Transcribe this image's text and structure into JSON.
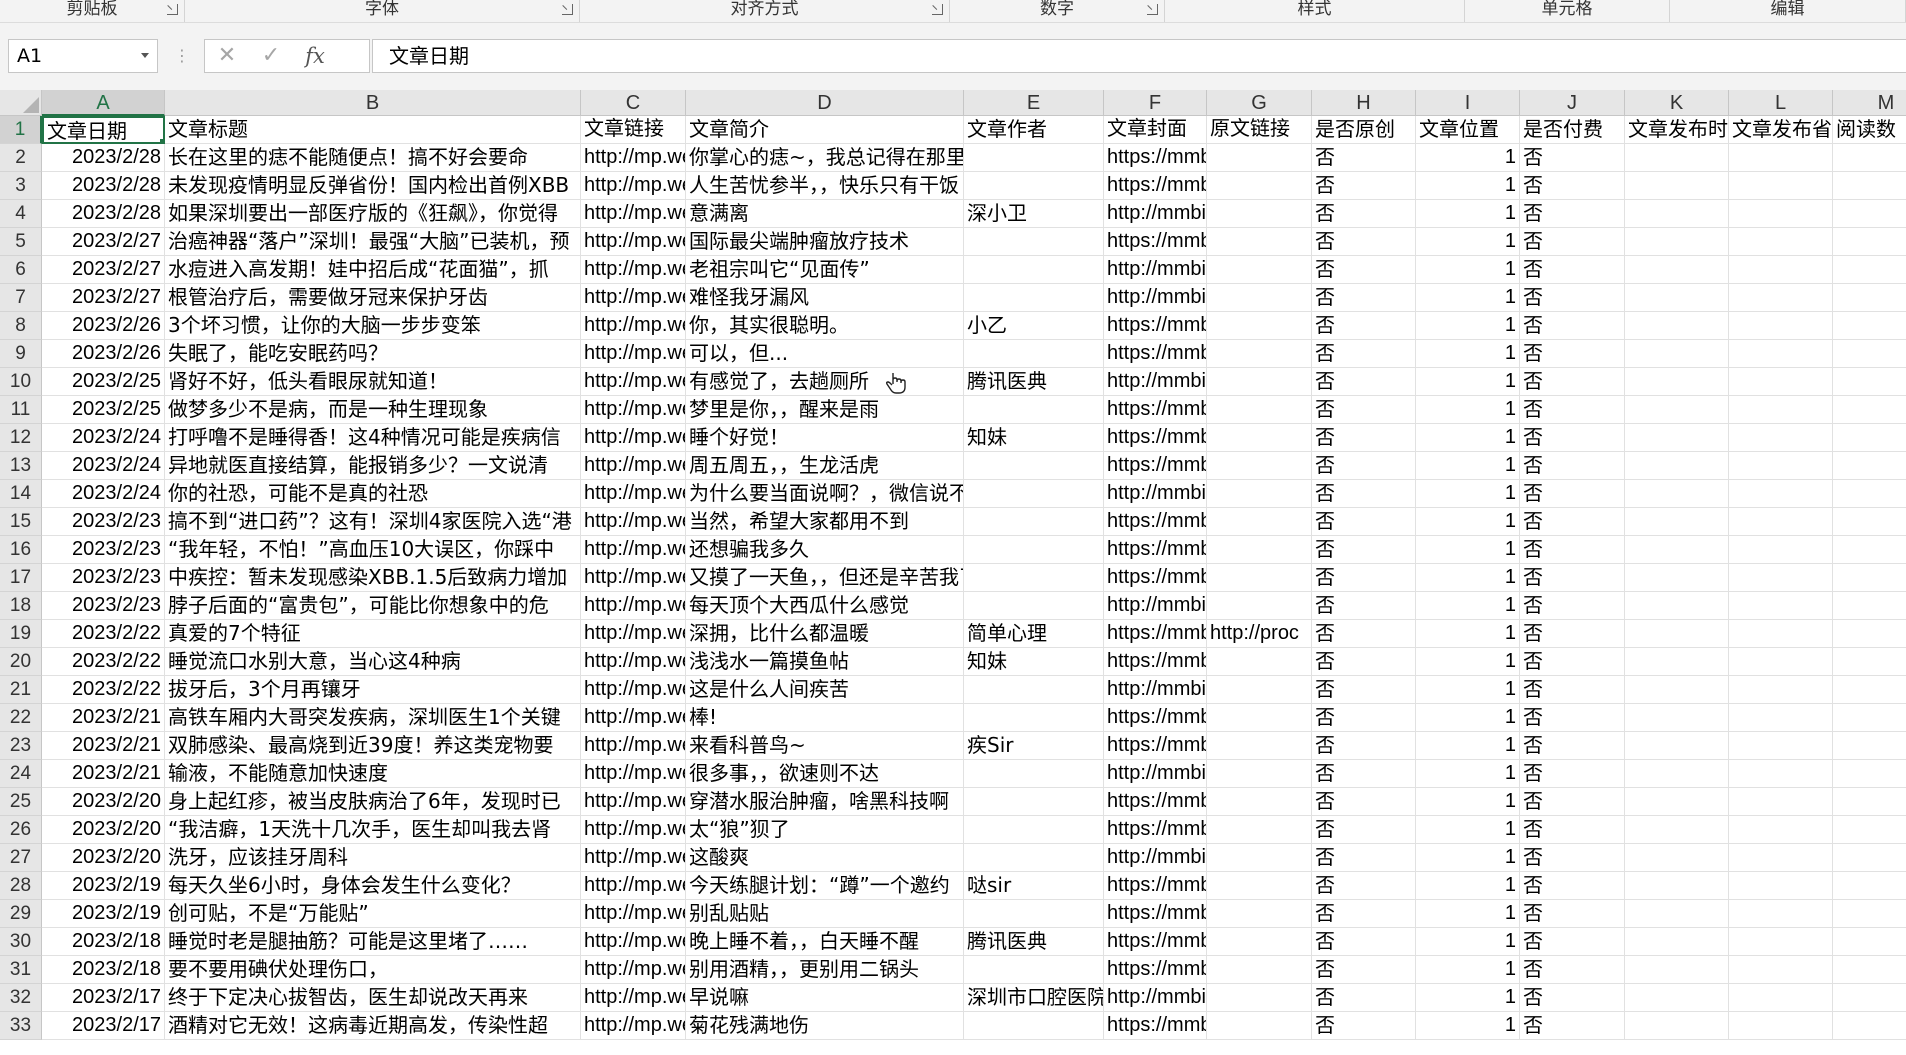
{
  "ribbon_groups": [
    {
      "label": "剪贴板",
      "launcher": true
    },
    {
      "label": "字体",
      "launcher": true
    },
    {
      "label": "对齐方式",
      "launcher": true
    },
    {
      "label": "数字",
      "launcher": true
    },
    {
      "label": "样式",
      "launcher": false
    },
    {
      "label": "单元格",
      "launcher": false
    },
    {
      "label": "编辑",
      "launcher": false
    }
  ],
  "formula_bar": {
    "name_box": "A1",
    "cancel_icon": "✕",
    "enter_icon": "✓",
    "fx_label": "fx",
    "content": "文章日期"
  },
  "columns": [
    "A",
    "B",
    "C",
    "D",
    "E",
    "F",
    "G",
    "H",
    "I",
    "J",
    "K",
    "L",
    "M"
  ],
  "selected_cell": "A1",
  "rows": [
    {
      "n": "1",
      "cells": [
        "文章日期",
        "文章标题",
        "文章链接",
        "文章简介",
        "文章作者",
        "文章封面",
        "原文链接",
        "是否原创",
        "文章位置",
        "是否付费",
        "文章发布时间",
        "文章发布省份",
        "阅读数"
      ]
    },
    {
      "n": "2",
      "cells": [
        "2023/2/28",
        "长在这里的痣不能随便点！搞不好会要命",
        "http://mp.weixin.qq.com",
        "你掌心的痣~，我总记得在那里",
        "",
        "https://mmbiz.qpic.cn",
        "",
        "否",
        "1",
        "否",
        "",
        "",
        ""
      ]
    },
    {
      "n": "3",
      "cells": [
        "2023/2/28",
        "未发现疫情明显反弹省份！国内检出首例XBB",
        "http://mp.weixin.qq.com",
        "人生苦忧参半，，快乐只有干饭",
        "",
        "https://mmbiz.qpic.cn",
        "",
        "否",
        "1",
        "否",
        "",
        "",
        ""
      ]
    },
    {
      "n": "4",
      "cells": [
        "2023/2/28",
        "如果深圳要出一部医疗版的《狂飙》，你觉得",
        "http://mp.weixin.qq.com",
        "意满离",
        "深小卫",
        "http://mmbiz.qpic.cn/",
        "",
        "否",
        "1",
        "否",
        "",
        "",
        ""
      ]
    },
    {
      "n": "5",
      "cells": [
        "2023/2/27",
        "治癌神器“落户”深圳！最强“大脑”已装机，预",
        "http://mp.weixin.qq.com",
        "国际最尖端肿瘤放疗技术",
        "",
        "https://mmbiz.qpic.cn",
        "",
        "否",
        "1",
        "否",
        "",
        "",
        ""
      ]
    },
    {
      "n": "6",
      "cells": [
        "2023/2/27",
        "水痘进入高发期！娃中招后成“花面猫”，抓",
        "http://mp.weixin.qq.com",
        "老祖宗叫它“见面传”",
        "",
        "http://mmbiz.qpic.cn/",
        "",
        "否",
        "1",
        "否",
        "",
        "",
        ""
      ]
    },
    {
      "n": "7",
      "cells": [
        "2023/2/27",
        "根管治疗后，需要做牙冠来保护牙齿",
        "http://mp.weixin.qq.com",
        "难怪我牙漏风",
        "",
        "http://mmbiz.qpic.cn/",
        "",
        "否",
        "1",
        "否",
        "",
        "",
        ""
      ]
    },
    {
      "n": "8",
      "cells": [
        "2023/2/26",
        "3个坏习惯，让你的大脑一步步变笨",
        "http://mp.weixin.qq.com",
        "你，其实很聪明。",
        "小乙",
        "https://mmbiz.qpic.cn",
        "",
        "否",
        "1",
        "否",
        "",
        "",
        ""
      ]
    },
    {
      "n": "9",
      "cells": [
        "2023/2/26",
        "失眠了，能吃安眠药吗？",
        "http://mp.weixin.qq.com",
        "可以，但...",
        "",
        "https://mmbiz.qpic.cn",
        "",
        "否",
        "1",
        "否",
        "",
        "",
        ""
      ]
    },
    {
      "n": "10",
      "cells": [
        "2023/2/25",
        "肾好不好，低头看眼尿就知道！",
        "http://mp.weixin.qq.com",
        "有感觉了，去趟厕所",
        "腾讯医典",
        "http://mmbiz.qpic.cn/",
        "",
        "否",
        "1",
        "否",
        "",
        "",
        ""
      ]
    },
    {
      "n": "11",
      "cells": [
        "2023/2/25",
        "做梦多少不是病，而是一种生理现象",
        "http://mp.weixin.qq.com",
        "梦里是你，，醒来是雨",
        "",
        "https://mmbiz.qpic.cn",
        "",
        "否",
        "1",
        "否",
        "",
        "",
        ""
      ]
    },
    {
      "n": "12",
      "cells": [
        "2023/2/24",
        "打呼噜不是睡得香！这4种情况可能是疾病信",
        "http://mp.weixin.qq.com",
        "睡个好觉！",
        "知妹",
        "https://mmbiz.qpic.cn",
        "",
        "否",
        "1",
        "否",
        "",
        "",
        ""
      ]
    },
    {
      "n": "13",
      "cells": [
        "2023/2/24",
        "异地就医直接结算，能报销多少？一文说清",
        "http://mp.weixin.qq.com",
        "周五周五，，生龙活虎",
        "",
        "https://mmbiz.qpic.cn",
        "",
        "否",
        "1",
        "否",
        "",
        "",
        ""
      ]
    },
    {
      "n": "14",
      "cells": [
        "2023/2/24",
        "你的社恐，可能不是真的社恐",
        "http://mp.weixin.qq.com",
        "为什么要当面说啊？，微信说不行吗",
        "",
        "http://mmbiz.qpic.cn/",
        "",
        "否",
        "1",
        "否",
        "",
        "",
        ""
      ]
    },
    {
      "n": "15",
      "cells": [
        "2023/2/23",
        "搞不到“进口药”？这有！深圳4家医院入选“港",
        "http://mp.weixin.qq.com",
        "当然，希望大家都用不到",
        "",
        "https://mmbiz.qpic.cn",
        "",
        "否",
        "1",
        "否",
        "",
        "",
        ""
      ]
    },
    {
      "n": "16",
      "cells": [
        "2023/2/23",
        "“我年轻，不怕！”高血压10大误区，你踩中",
        "http://mp.weixin.qq.com",
        "还想骗我多久",
        "",
        "https://mmbiz.qpic.cn",
        "",
        "否",
        "1",
        "否",
        "",
        "",
        ""
      ]
    },
    {
      "n": "17",
      "cells": [
        "2023/2/23",
        "中疾控：暂未发现感染XBB.1.5后致病力增加",
        "http://mp.weixin.qq.com",
        "又摸了一天鱼，，但还是辛苦我了",
        "",
        "https://mmbiz.qpic.cn",
        "",
        "否",
        "1",
        "否",
        "",
        "",
        ""
      ]
    },
    {
      "n": "18",
      "cells": [
        "2023/2/23",
        "脖子后面的“富贵包”，可能比你想象中的危",
        "http://mp.weixin.qq.com",
        "每天顶个大西瓜什么感觉",
        "",
        "http://mmbiz.qpic.cn/",
        "",
        "否",
        "1",
        "否",
        "",
        "",
        ""
      ]
    },
    {
      "n": "19",
      "cells": [
        "2023/2/22",
        "真爱的7个特征",
        "http://mp.weixin.qq.com",
        "深拥，比什么都温暖",
        "简单心理",
        "https://mmbiz.qpic.cn",
        "http://proc",
        "否",
        "1",
        "否",
        "",
        "",
        ""
      ]
    },
    {
      "n": "20",
      "cells": [
        "2023/2/22",
        "睡觉流口水别大意，当心这4种病",
        "http://mp.weixin.qq.com",
        "浅浅水一篇摸鱼帖",
        "知妹",
        "https://mmbiz.qpic.cn",
        "",
        "否",
        "1",
        "否",
        "",
        "",
        ""
      ]
    },
    {
      "n": "21",
      "cells": [
        "2023/2/22",
        "拔牙后，3个月再镶牙",
        "http://mp.weixin.qq.com",
        "这是什么人间疾苦",
        "",
        "http://mmbiz.qpic.cn/",
        "",
        "否",
        "1",
        "否",
        "",
        "",
        ""
      ]
    },
    {
      "n": "22",
      "cells": [
        "2023/2/21",
        "高铁车厢内大哥突发疾病，深圳医生1个关键",
        "http://mp.weixin.qq.com",
        "棒!",
        "",
        "https://mmbiz.qpic.cn",
        "",
        "否",
        "1",
        "否",
        "",
        "",
        ""
      ]
    },
    {
      "n": "23",
      "cells": [
        "2023/2/21",
        "双肺感染、最高烧到近39度！养这类宠物要",
        "http://mp.weixin.qq.com",
        "来看科普鸟~",
        "疾Sir",
        "https://mmbiz.qpic.cn",
        "",
        "否",
        "1",
        "否",
        "",
        "",
        ""
      ]
    },
    {
      "n": "24",
      "cells": [
        "2023/2/21",
        "输液，不能随意加快速度",
        "http://mp.weixin.qq.com",
        "很多事，，欲速则不达",
        "",
        "http://mmbiz.qpic.cn/",
        "",
        "否",
        "1",
        "否",
        "",
        "",
        ""
      ]
    },
    {
      "n": "25",
      "cells": [
        "2023/2/20",
        "身上起红疹，被当皮肤病治了6年，发现时已",
        "http://mp.weixin.qq.com",
        "穿潜水服治肿瘤，啥黑科技啊",
        "",
        "https://mmbiz.qpic.cn",
        "",
        "否",
        "1",
        "否",
        "",
        "",
        ""
      ]
    },
    {
      "n": "26",
      "cells": [
        "2023/2/20",
        "“我洁癖，1天洗十几次手，医生却叫我去肾",
        "http://mp.weixin.qq.com",
        "太“狼”狈了",
        "",
        "https://mmbiz.qpic.cn",
        "",
        "否",
        "1",
        "否",
        "",
        "",
        ""
      ]
    },
    {
      "n": "27",
      "cells": [
        "2023/2/20",
        "洗牙，应该挂牙周科",
        "http://mp.weixin.qq.com",
        "这酸爽",
        "",
        "http://mmbiz.qpic.cn/",
        "",
        "否",
        "1",
        "否",
        "",
        "",
        ""
      ]
    },
    {
      "n": "28",
      "cells": [
        "2023/2/19",
        "每天久坐6小时，身体会发生什么变化？",
        "http://mp.weixin.qq.com",
        "今天练腿计划：“蹲”一个邀约",
        "哒sir",
        "https://mmbiz.qpic.cn",
        "",
        "否",
        "1",
        "否",
        "",
        "",
        ""
      ]
    },
    {
      "n": "29",
      "cells": [
        "2023/2/19",
        "创可贴，不是“万能贴”",
        "http://mp.weixin.qq.com",
        "别乱贴贴",
        "",
        "https://mmbiz.qpic.cn",
        "",
        "否",
        "1",
        "否",
        "",
        "",
        ""
      ]
    },
    {
      "n": "30",
      "cells": [
        "2023/2/18",
        "睡觉时老是腿抽筋？可能是这里堵了……",
        "http://mp.weixin.qq.com",
        "晚上睡不着，，白天睡不醒",
        "腾讯医典",
        "https://mmbiz.qpic.cn",
        "",
        "否",
        "1",
        "否",
        "",
        "",
        ""
      ]
    },
    {
      "n": "31",
      "cells": [
        "2023/2/18",
        "要不要用碘伏处理伤口，",
        "http://mp.weixin.qq.com",
        "别用酒精，，更别用二锅头",
        "",
        "https://mmbiz.qpic.cn",
        "",
        "否",
        "1",
        "否",
        "",
        "",
        ""
      ]
    },
    {
      "n": "32",
      "cells": [
        "2023/2/17",
        "终于下定决心拔智齿，医生却说改天再来",
        "http://mp.weixin.qq.com",
        "早说嘛",
        "深圳市口腔医院",
        "http://mmbiz.qpic.cn/",
        "",
        "否",
        "1",
        "否",
        "",
        "",
        ""
      ]
    },
    {
      "n": "33",
      "cells": [
        "2023/2/17",
        "酒精对它无效！这病毒近期高发，传染性超",
        "http://mp.weixin.qq.com",
        "菊花残满地伤",
        "",
        "https://mmbiz.qpic.cn",
        "",
        "否",
        "1",
        "否",
        "",
        "",
        ""
      ]
    }
  ]
}
